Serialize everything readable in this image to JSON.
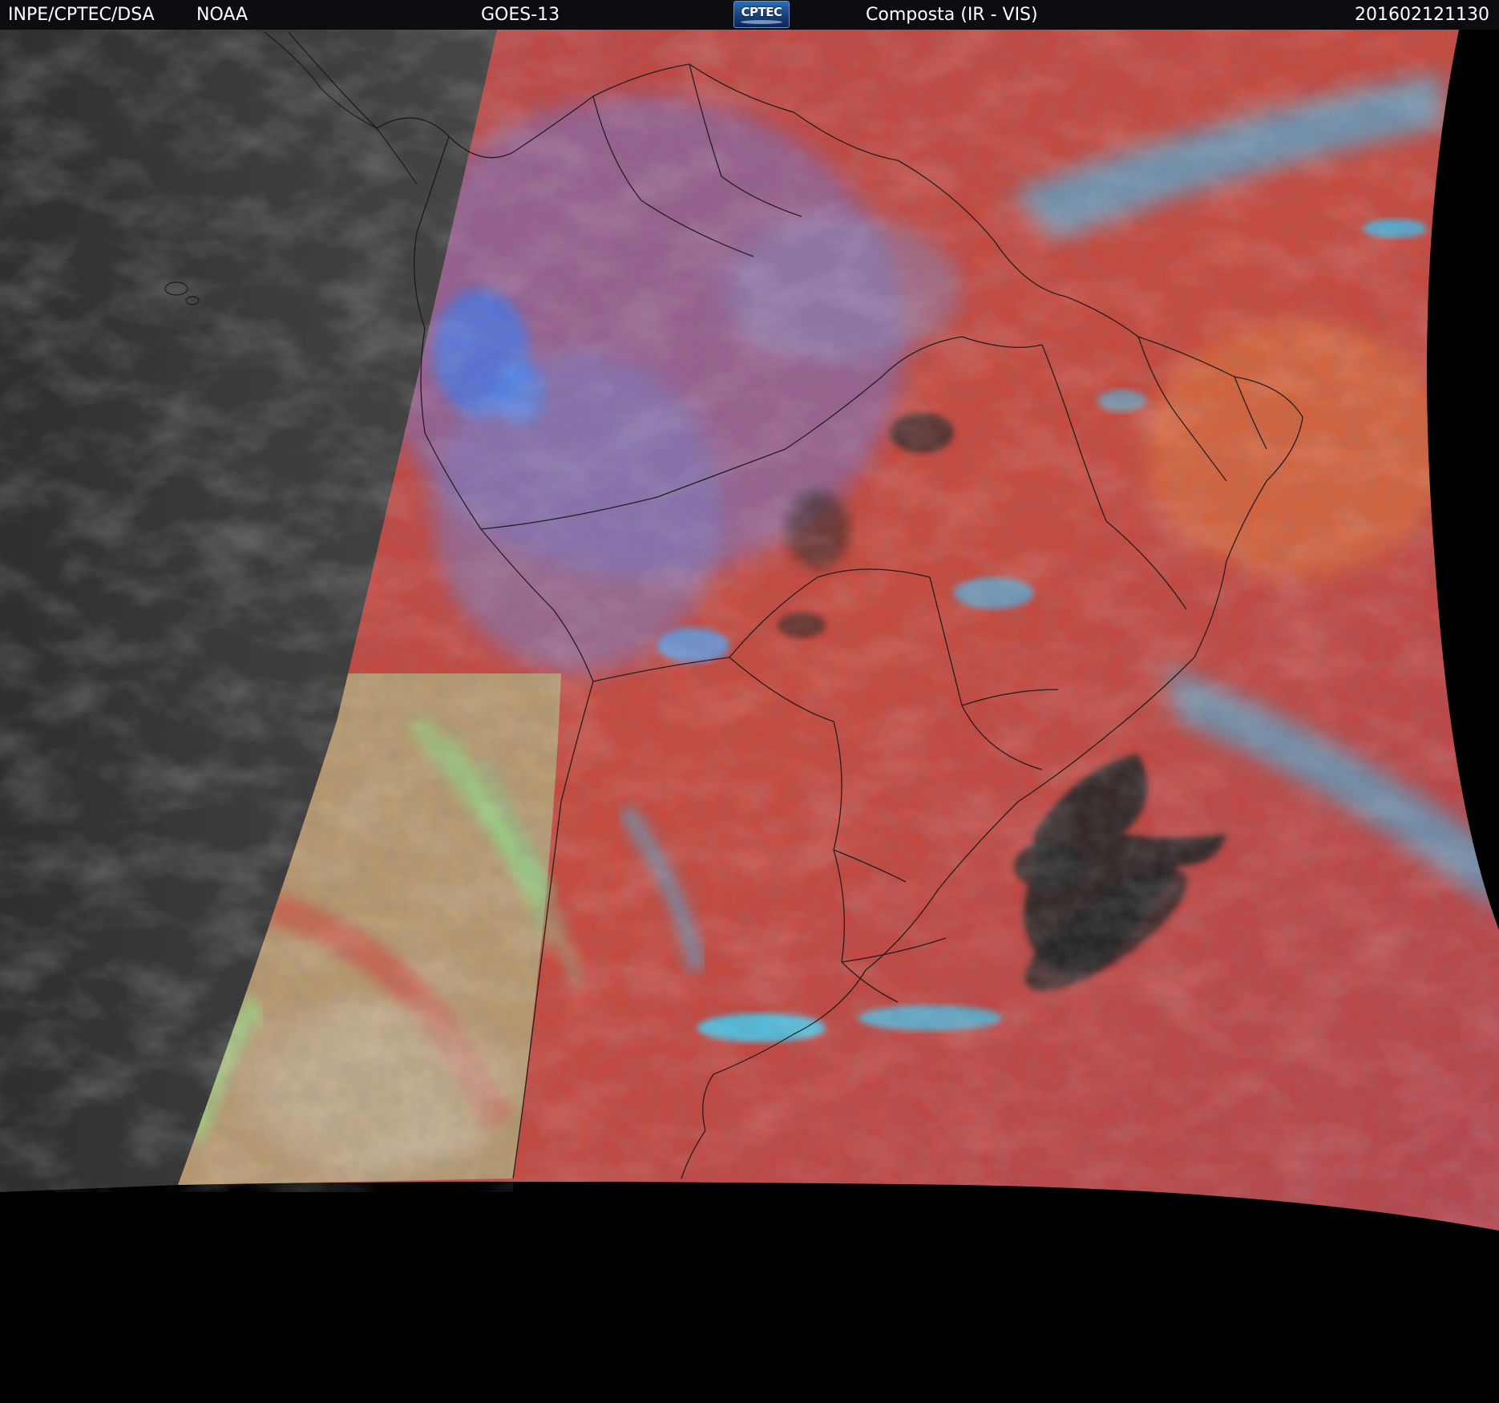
{
  "header": {
    "institution": "INPE/CPTEC/DSA",
    "agency": "NOAA",
    "satellite": "GOES-13",
    "logo_text": "CPTEC",
    "product": "Composta (IR - VIS)",
    "timestamp": "201602121130"
  },
  "colors": {
    "header_background": "#0b0d10",
    "no_data": "#000000",
    "ir_gray": "#3c3c3c",
    "composite_red": "#c8453f",
    "cold_cloud_cyan": "#45b8e8",
    "low_cloud_green": "#8fe08a",
    "coastline": "#1a1a1a"
  }
}
